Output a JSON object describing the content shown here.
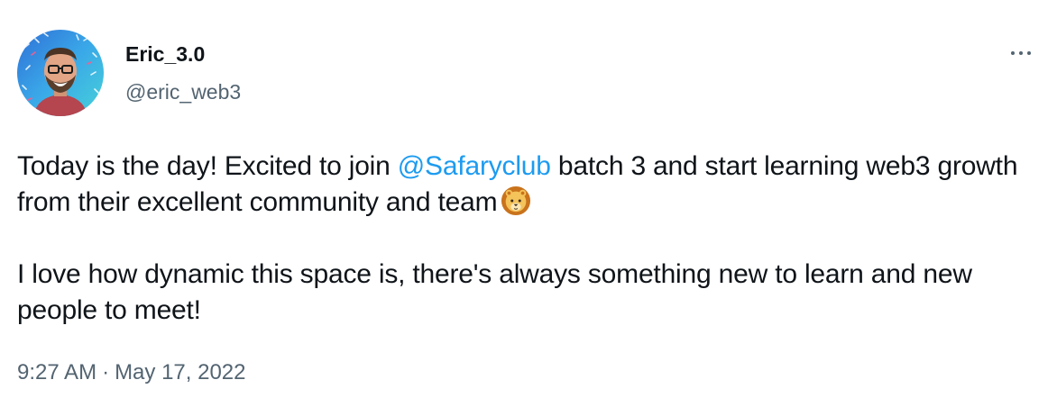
{
  "author": {
    "name": "Eric_3.0",
    "handle": "@eric_web3",
    "avatar_icon": "avatar-photo"
  },
  "menu": {
    "icon": "more-options-icon"
  },
  "tweet": {
    "line1_pre": "Today is the day! Excited to join ",
    "mention": "@Safaryclub",
    "line1_post": " batch 3 and start learning web3 growth from their excellent community and team",
    "emoji": "lion-face-emoji",
    "paragraph2": "I love how dynamic this space is, there's always something new to learn and new people to meet!"
  },
  "meta": {
    "time": "9:27 AM",
    "separator": "·",
    "date": "May 17, 2022"
  },
  "colors": {
    "text": "#0f1419",
    "secondary": "#536471",
    "link": "#1d9bf0",
    "background": "#ffffff"
  }
}
